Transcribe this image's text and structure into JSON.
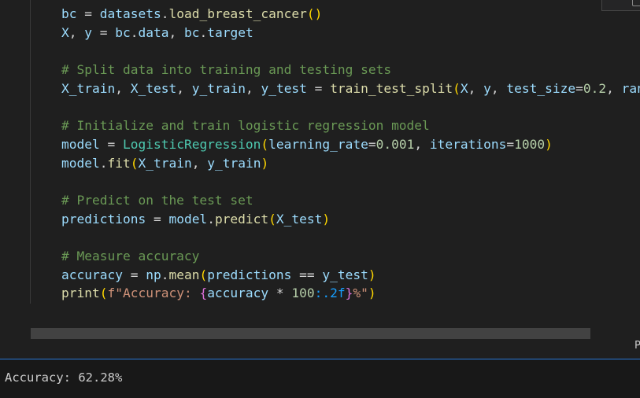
{
  "editor": {
    "lines": [
      {
        "id": "load-dataset",
        "tokens": [
          {
            "t": "bc",
            "c": "var"
          },
          {
            "t": " = ",
            "c": "op"
          },
          {
            "t": "datasets",
            "c": "var"
          },
          {
            "t": ".",
            "c": "op"
          },
          {
            "t": "load_breast_cancer",
            "c": "fn"
          },
          {
            "t": "()",
            "c": "p1"
          }
        ]
      },
      {
        "id": "assign-xy",
        "tokens": [
          {
            "t": "X",
            "c": "var"
          },
          {
            "t": ", ",
            "c": "op"
          },
          {
            "t": "y",
            "c": "var"
          },
          {
            "t": " = ",
            "c": "op"
          },
          {
            "t": "bc",
            "c": "var"
          },
          {
            "t": ".",
            "c": "op"
          },
          {
            "t": "data",
            "c": "var"
          },
          {
            "t": ", ",
            "c": "op"
          },
          {
            "t": "bc",
            "c": "var"
          },
          {
            "t": ".",
            "c": "op"
          },
          {
            "t": "target",
            "c": "var"
          }
        ]
      },
      {
        "id": "blank-1",
        "tokens": []
      },
      {
        "id": "comment-split",
        "tokens": [
          {
            "t": "# Split data into training and testing sets",
            "c": "cm"
          }
        ]
      },
      {
        "id": "train-test-split",
        "tokens": [
          {
            "t": "X_train",
            "c": "var"
          },
          {
            "t": ", ",
            "c": "op"
          },
          {
            "t": "X_test",
            "c": "var"
          },
          {
            "t": ", ",
            "c": "op"
          },
          {
            "t": "y_train",
            "c": "var"
          },
          {
            "t": ", ",
            "c": "op"
          },
          {
            "t": "y_test",
            "c": "var"
          },
          {
            "t": " = ",
            "c": "op"
          },
          {
            "t": "train_test_split",
            "c": "fn"
          },
          {
            "t": "(",
            "c": "p1"
          },
          {
            "t": "X",
            "c": "var"
          },
          {
            "t": ", ",
            "c": "op"
          },
          {
            "t": "y",
            "c": "var"
          },
          {
            "t": ", ",
            "c": "op"
          },
          {
            "t": "test_size",
            "c": "param"
          },
          {
            "t": "=",
            "c": "op"
          },
          {
            "t": "0.2",
            "c": "num"
          },
          {
            "t": ", ",
            "c": "op"
          },
          {
            "t": "rand",
            "c": "param"
          }
        ]
      },
      {
        "id": "blank-2",
        "tokens": []
      },
      {
        "id": "comment-init",
        "tokens": [
          {
            "t": "# Initialize and train logistic regression model",
            "c": "cm"
          }
        ]
      },
      {
        "id": "model-init",
        "tokens": [
          {
            "t": "model",
            "c": "var"
          },
          {
            "t": " = ",
            "c": "op"
          },
          {
            "t": "LogisticRegression",
            "c": "cls"
          },
          {
            "t": "(",
            "c": "p1"
          },
          {
            "t": "learning_rate",
            "c": "param"
          },
          {
            "t": "=",
            "c": "op"
          },
          {
            "t": "0.001",
            "c": "num"
          },
          {
            "t": ", ",
            "c": "op"
          },
          {
            "t": "iterations",
            "c": "param"
          },
          {
            "t": "=",
            "c": "op"
          },
          {
            "t": "1000",
            "c": "num"
          },
          {
            "t": ")",
            "c": "p1"
          }
        ]
      },
      {
        "id": "model-fit",
        "tokens": [
          {
            "t": "model",
            "c": "var"
          },
          {
            "t": ".",
            "c": "op"
          },
          {
            "t": "fit",
            "c": "fn"
          },
          {
            "t": "(",
            "c": "p1"
          },
          {
            "t": "X_train",
            "c": "var"
          },
          {
            "t": ", ",
            "c": "op"
          },
          {
            "t": "y_train",
            "c": "var"
          },
          {
            "t": ")",
            "c": "p1"
          }
        ]
      },
      {
        "id": "blank-3",
        "tokens": []
      },
      {
        "id": "comment-predict",
        "tokens": [
          {
            "t": "# Predict on the test set",
            "c": "cm"
          }
        ]
      },
      {
        "id": "predictions",
        "tokens": [
          {
            "t": "predictions",
            "c": "var"
          },
          {
            "t": " = ",
            "c": "op"
          },
          {
            "t": "model",
            "c": "var"
          },
          {
            "t": ".",
            "c": "op"
          },
          {
            "t": "predict",
            "c": "fn"
          },
          {
            "t": "(",
            "c": "p1"
          },
          {
            "t": "X_test",
            "c": "var"
          },
          {
            "t": ")",
            "c": "p1"
          }
        ]
      },
      {
        "id": "blank-4",
        "tokens": []
      },
      {
        "id": "comment-accuracy",
        "tokens": [
          {
            "t": "# Measure accuracy",
            "c": "cm"
          }
        ]
      },
      {
        "id": "accuracy",
        "tokens": [
          {
            "t": "accuracy",
            "c": "var"
          },
          {
            "t": " = ",
            "c": "op"
          },
          {
            "t": "np",
            "c": "var"
          },
          {
            "t": ".",
            "c": "op"
          },
          {
            "t": "mean",
            "c": "fn"
          },
          {
            "t": "(",
            "c": "p1"
          },
          {
            "t": "predictions",
            "c": "var"
          },
          {
            "t": " == ",
            "c": "op"
          },
          {
            "t": "y_test",
            "c": "var"
          },
          {
            "t": ")",
            "c": "p1"
          }
        ]
      },
      {
        "id": "print",
        "tokens": [
          {
            "t": "print",
            "c": "fn"
          },
          {
            "t": "(",
            "c": "p1"
          },
          {
            "t": "f\"Accuracy: ",
            "c": "str"
          },
          {
            "t": "{",
            "c": "p2"
          },
          {
            "t": "accuracy",
            "c": "var"
          },
          {
            "t": " * ",
            "c": "op"
          },
          {
            "t": "100",
            "c": "num"
          },
          {
            "t": ":.2f",
            "c": "p3"
          },
          {
            "t": "}",
            "c": "p2"
          },
          {
            "t": "%\"",
            "c": "str"
          },
          {
            "t": ")",
            "c": "p1"
          }
        ]
      }
    ]
  },
  "side_letter": "P",
  "output": {
    "text": "Accuracy: 62.28%"
  }
}
